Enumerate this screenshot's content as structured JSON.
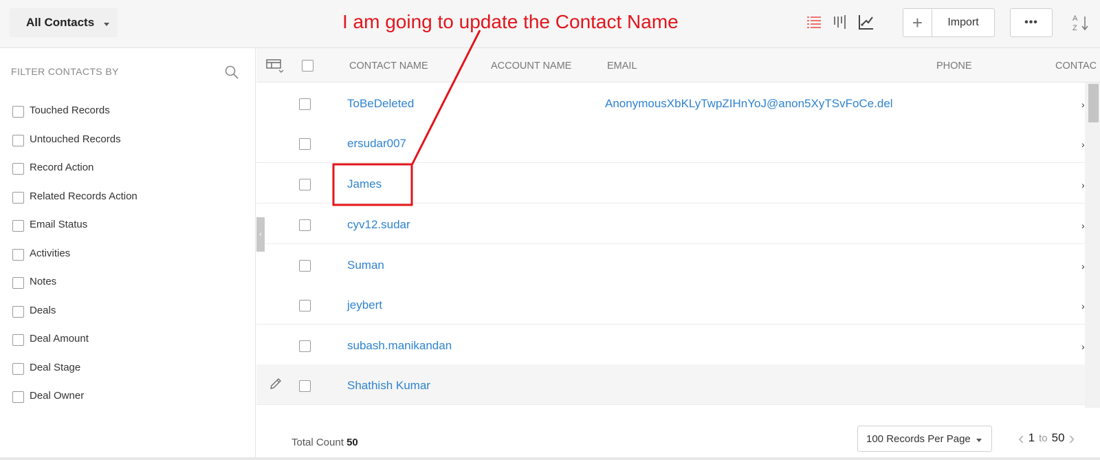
{
  "header": {
    "view_label": "All Contacts",
    "annotation": "I am going to update the Contact Name",
    "plus_label": "+",
    "import_label": "Import",
    "more_label": "•••"
  },
  "sidebar": {
    "title": "FILTER CONTACTS BY",
    "filters": [
      {
        "label": "Touched Records"
      },
      {
        "label": "Untouched Records"
      },
      {
        "label": "Record Action"
      },
      {
        "label": "Related Records Action"
      },
      {
        "label": "Email Status"
      },
      {
        "label": "Activities"
      },
      {
        "label": "Notes"
      },
      {
        "label": "Deals"
      },
      {
        "label": "Deal Amount"
      },
      {
        "label": "Deal Stage"
      },
      {
        "label": "Deal Owner"
      }
    ]
  },
  "table": {
    "columns": {
      "contact_name": "CONTACT NAME",
      "account_name": "ACCOUNT NAME",
      "email": "EMAIL",
      "phone": "PHONE",
      "contact_owner": "CONTAC"
    },
    "rows": [
      {
        "name": "ToBeDeleted",
        "email": "AnonymousXbKLyTwpZIHnYoJ@anon5XyTSvFoCe.del",
        "trail": "›"
      },
      {
        "name": "ersudar007",
        "email": "",
        "trail": "›"
      },
      {
        "name": "James",
        "email": "",
        "trail": "›"
      },
      {
        "name": "cyv12.sudar",
        "email": "",
        "trail": "›"
      },
      {
        "name": "Suman",
        "email": "",
        "trail": "›"
      },
      {
        "name": "jeybert",
        "email": "",
        "trail": "›"
      },
      {
        "name": "subash.manikandan",
        "email": "",
        "trail": "›"
      },
      {
        "name": "Shathish Kumar",
        "email": "",
        "trail": ""
      }
    ]
  },
  "footer": {
    "total_label": "Total Count",
    "total_value": "50",
    "per_page": "100 Records Per Page",
    "page_from": "1",
    "page_to_word": "to",
    "page_to": "50"
  },
  "colors": {
    "annotation_red": "#e3141b",
    "link_blue": "#2f83d0",
    "active_view_icon": "#f07070"
  }
}
